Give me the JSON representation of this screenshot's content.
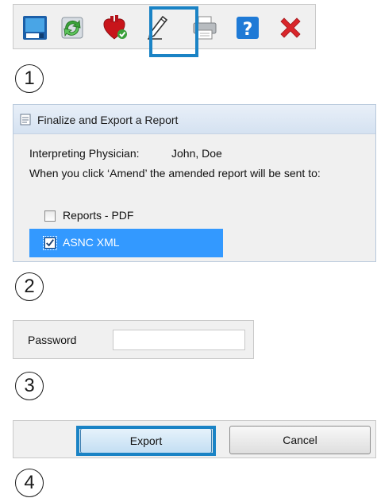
{
  "steps": [
    "1",
    "2",
    "3",
    "4"
  ],
  "toolbar": {
    "buttons": [
      {
        "icon": "save-icon"
      },
      {
        "icon": "refresh-icon"
      },
      {
        "icon": "heart-approve-icon"
      },
      {
        "icon": "pen-sign-icon",
        "highlighted": true
      },
      {
        "icon": "printer-icon"
      },
      {
        "icon": "help-icon"
      },
      {
        "icon": "close-icon"
      }
    ]
  },
  "dialog": {
    "title": "Finalize and Export a Report",
    "physician_label": "Interpreting Physician:",
    "physician_name": "John, Doe",
    "instruction": "When you click ‘Amend’ the amended report will be sent to:",
    "options": [
      {
        "label": "Reports - PDF",
        "checked": false,
        "selected": false
      },
      {
        "label": "ASNC XML",
        "checked": true,
        "selected": true
      }
    ]
  },
  "password": {
    "label": "Password",
    "value": ""
  },
  "actions": {
    "export_label": "Export",
    "cancel_label": "Cancel"
  },
  "colors": {
    "highlight": "#1a83c5",
    "selection": "#3399ff",
    "panel": "#f0f0f0"
  }
}
